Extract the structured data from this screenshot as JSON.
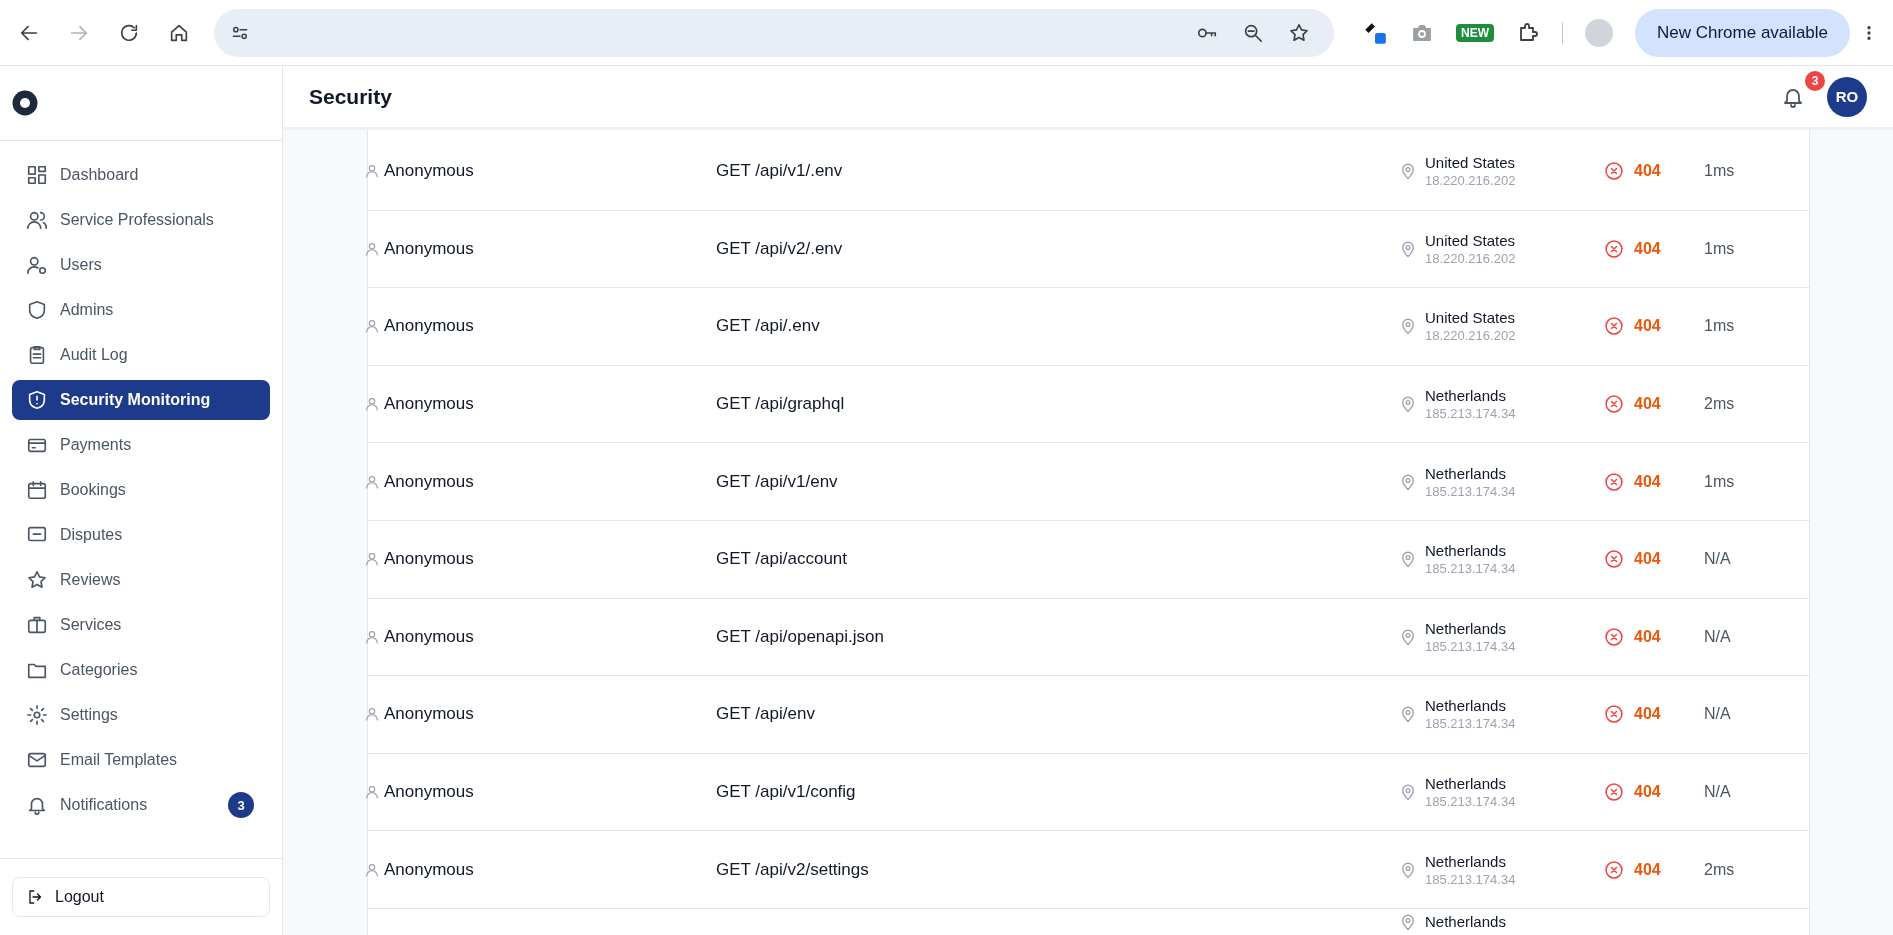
{
  "browser": {
    "forward_disabled": true,
    "extension_badge": "NEW",
    "update_button": "New Chrome available"
  },
  "sidebar": {
    "items": [
      {
        "label": "Dashboard",
        "selected": false
      },
      {
        "label": "Service Professionals",
        "selected": false
      },
      {
        "label": "Users",
        "selected": false
      },
      {
        "label": "Admins",
        "selected": false
      },
      {
        "label": "Audit Log",
        "selected": false
      },
      {
        "label": "Security Monitoring",
        "selected": true
      },
      {
        "label": "Payments",
        "selected": false
      },
      {
        "label": "Bookings",
        "selected": false
      },
      {
        "label": "Disputes",
        "selected": false
      },
      {
        "label": "Reviews",
        "selected": false
      },
      {
        "label": "Services",
        "selected": false
      },
      {
        "label": "Categories",
        "selected": false
      },
      {
        "label": "Settings",
        "selected": false
      },
      {
        "label": "Email Templates",
        "selected": false
      },
      {
        "label": "Notifications",
        "selected": false,
        "badge": "3"
      }
    ],
    "logout": "Logout"
  },
  "header": {
    "title": "Security",
    "notification_count": "3",
    "avatar": "RO"
  },
  "table": {
    "rows": [
      {
        "user": "Anonymous",
        "request": "GET /api/v1/.env",
        "country": "United States",
        "ip": "18.220.216.202",
        "failed": true,
        "status": "404",
        "time": "1ms"
      },
      {
        "user": "Anonymous",
        "request": "GET /api/v2/.env",
        "country": "United States",
        "ip": "18.220.216.202",
        "failed": true,
        "status": "404",
        "time": "1ms"
      },
      {
        "user": "Anonymous",
        "request": "GET /api/.env",
        "country": "United States",
        "ip": "18.220.216.202",
        "failed": true,
        "status": "404",
        "time": "1ms"
      },
      {
        "user": "Anonymous",
        "request": "GET /api/graphql",
        "country": "Netherlands",
        "ip": "185.213.174.34",
        "failed": true,
        "status": "404",
        "time": "2ms"
      },
      {
        "user": "Anonymous",
        "request": "GET /api/v1/env",
        "country": "Netherlands",
        "ip": "185.213.174.34",
        "failed": true,
        "status": "404",
        "time": "1ms"
      },
      {
        "user": "Anonymous",
        "request": "GET /api/account",
        "country": "Netherlands",
        "ip": "185.213.174.34",
        "failed": true,
        "status": "404",
        "time": "N/A"
      },
      {
        "user": "Anonymous",
        "request": "GET /api/openapi.json",
        "country": "Netherlands",
        "ip": "185.213.174.34",
        "failed": true,
        "status": "404",
        "time": "N/A"
      },
      {
        "user": "Anonymous",
        "request": "GET /api/env",
        "country": "Netherlands",
        "ip": "185.213.174.34",
        "failed": true,
        "status": "404",
        "time": "N/A"
      },
      {
        "user": "Anonymous",
        "request": "GET /api/v1/config",
        "country": "Netherlands",
        "ip": "185.213.174.34",
        "failed": true,
        "status": "404",
        "time": "N/A"
      },
      {
        "user": "Anonymous",
        "request": "GET /api/v2/settings",
        "country": "Netherlands",
        "ip": "185.213.174.34",
        "failed": true,
        "status": "404",
        "time": "2ms"
      },
      {
        "country": "Netherlands"
      }
    ]
  }
}
